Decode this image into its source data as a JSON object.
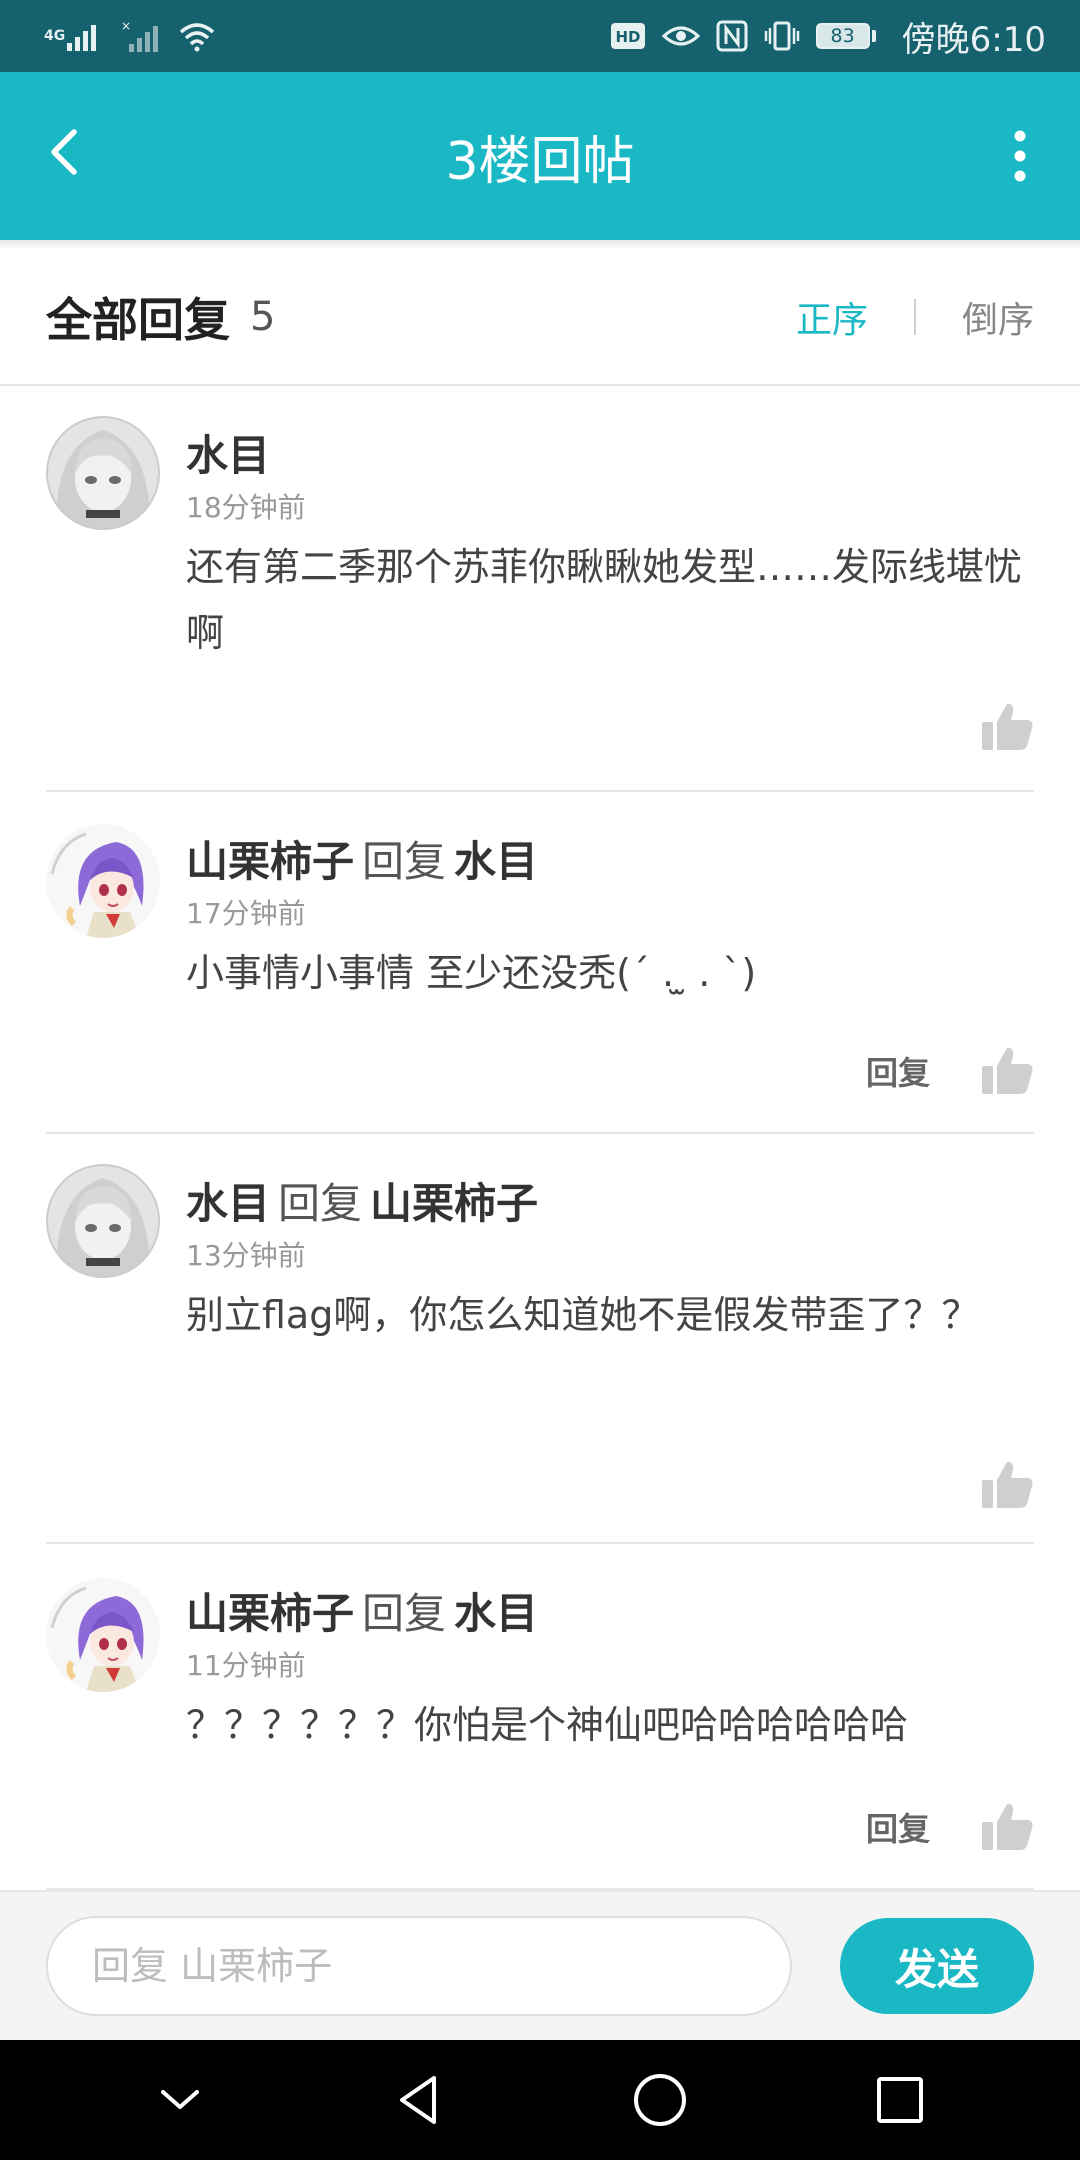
{
  "status_bar": {
    "network_label": "4G",
    "battery": "83",
    "time": "傍晚6:10",
    "icons": [
      "signal-icon",
      "no-signal-icon",
      "wifi-icon",
      "hd-icon",
      "eye-icon",
      "nfc-icon",
      "vibrate-icon",
      "battery-icon"
    ]
  },
  "header": {
    "title": "3楼回帖",
    "back_icon": "chevron-left-icon",
    "more_icon": "more-vertical-icon",
    "color": "#1ab8c4"
  },
  "replies_header": {
    "title": "全部回复",
    "count": "5",
    "sort_asc": "正序",
    "sort_desc": "倒序",
    "active_sort": "正序"
  },
  "replies": [
    {
      "author": "水目",
      "reply_word": "",
      "reply_to": "",
      "time": "18分钟前",
      "text": "还有第二季那个苏菲你瞅瞅她发型……发际线堪忧啊",
      "show_reply": false,
      "reply_label": "回复"
    },
    {
      "author": "山栗柿子",
      "reply_word": "回复",
      "reply_to": "水目",
      "time": "17分钟前",
      "text": "小事情小事情 至少还没秃(´ . ̫ . `)",
      "show_reply": true,
      "reply_label": "回复"
    },
    {
      "author": "水目",
      "reply_word": "回复",
      "reply_to": "山栗柿子",
      "time": "13分钟前",
      "text": "别立flag啊，你怎么知道她不是假发带歪了？？",
      "show_reply": false,
      "reply_label": "回复"
    },
    {
      "author": "山栗柿子",
      "reply_word": "回复",
      "reply_to": "水目",
      "time": "11分钟前",
      "text": "？？？？？？你怕是个神仙吧哈哈哈哈哈哈",
      "show_reply": true,
      "reply_label": "回复"
    }
  ],
  "input_bar": {
    "placeholder": "回复 山栗柿子",
    "value": "",
    "send_label": "发送"
  },
  "nav_bar": {
    "icons": [
      "nav-down-icon",
      "nav-back-icon",
      "nav-home-icon",
      "nav-recents-icon"
    ]
  }
}
